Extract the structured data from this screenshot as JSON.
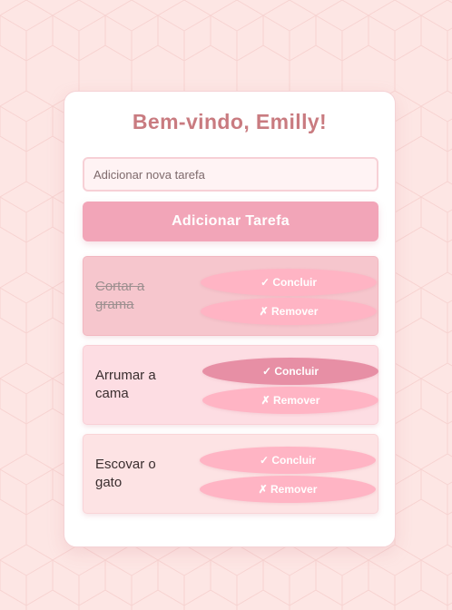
{
  "header": {
    "title": "Bem-vindo, Emilly!"
  },
  "new_task": {
    "placeholder": "Adicionar nova tarefa",
    "value": "",
    "add_label": "Adicionar Tarefa"
  },
  "actions": {
    "complete_label": "✓ Concluir",
    "remove_label": "✗ Remover"
  },
  "tasks": [
    {
      "text": "Cortar a grama",
      "completed": true
    },
    {
      "text": "Arrumar a cama",
      "completed": false
    },
    {
      "text": "Escovar o gato",
      "completed": false
    }
  ],
  "colors": {
    "page_background": "#fde6e4",
    "title": "#c97b80",
    "accent": "#f2a5b8",
    "task_completed_background": "#f6c6cd",
    "task_background": "#fddde3",
    "task_background_alt": "#fde3e4",
    "pill": "#ffb4c4",
    "pill_active": "#e78fa5"
  }
}
